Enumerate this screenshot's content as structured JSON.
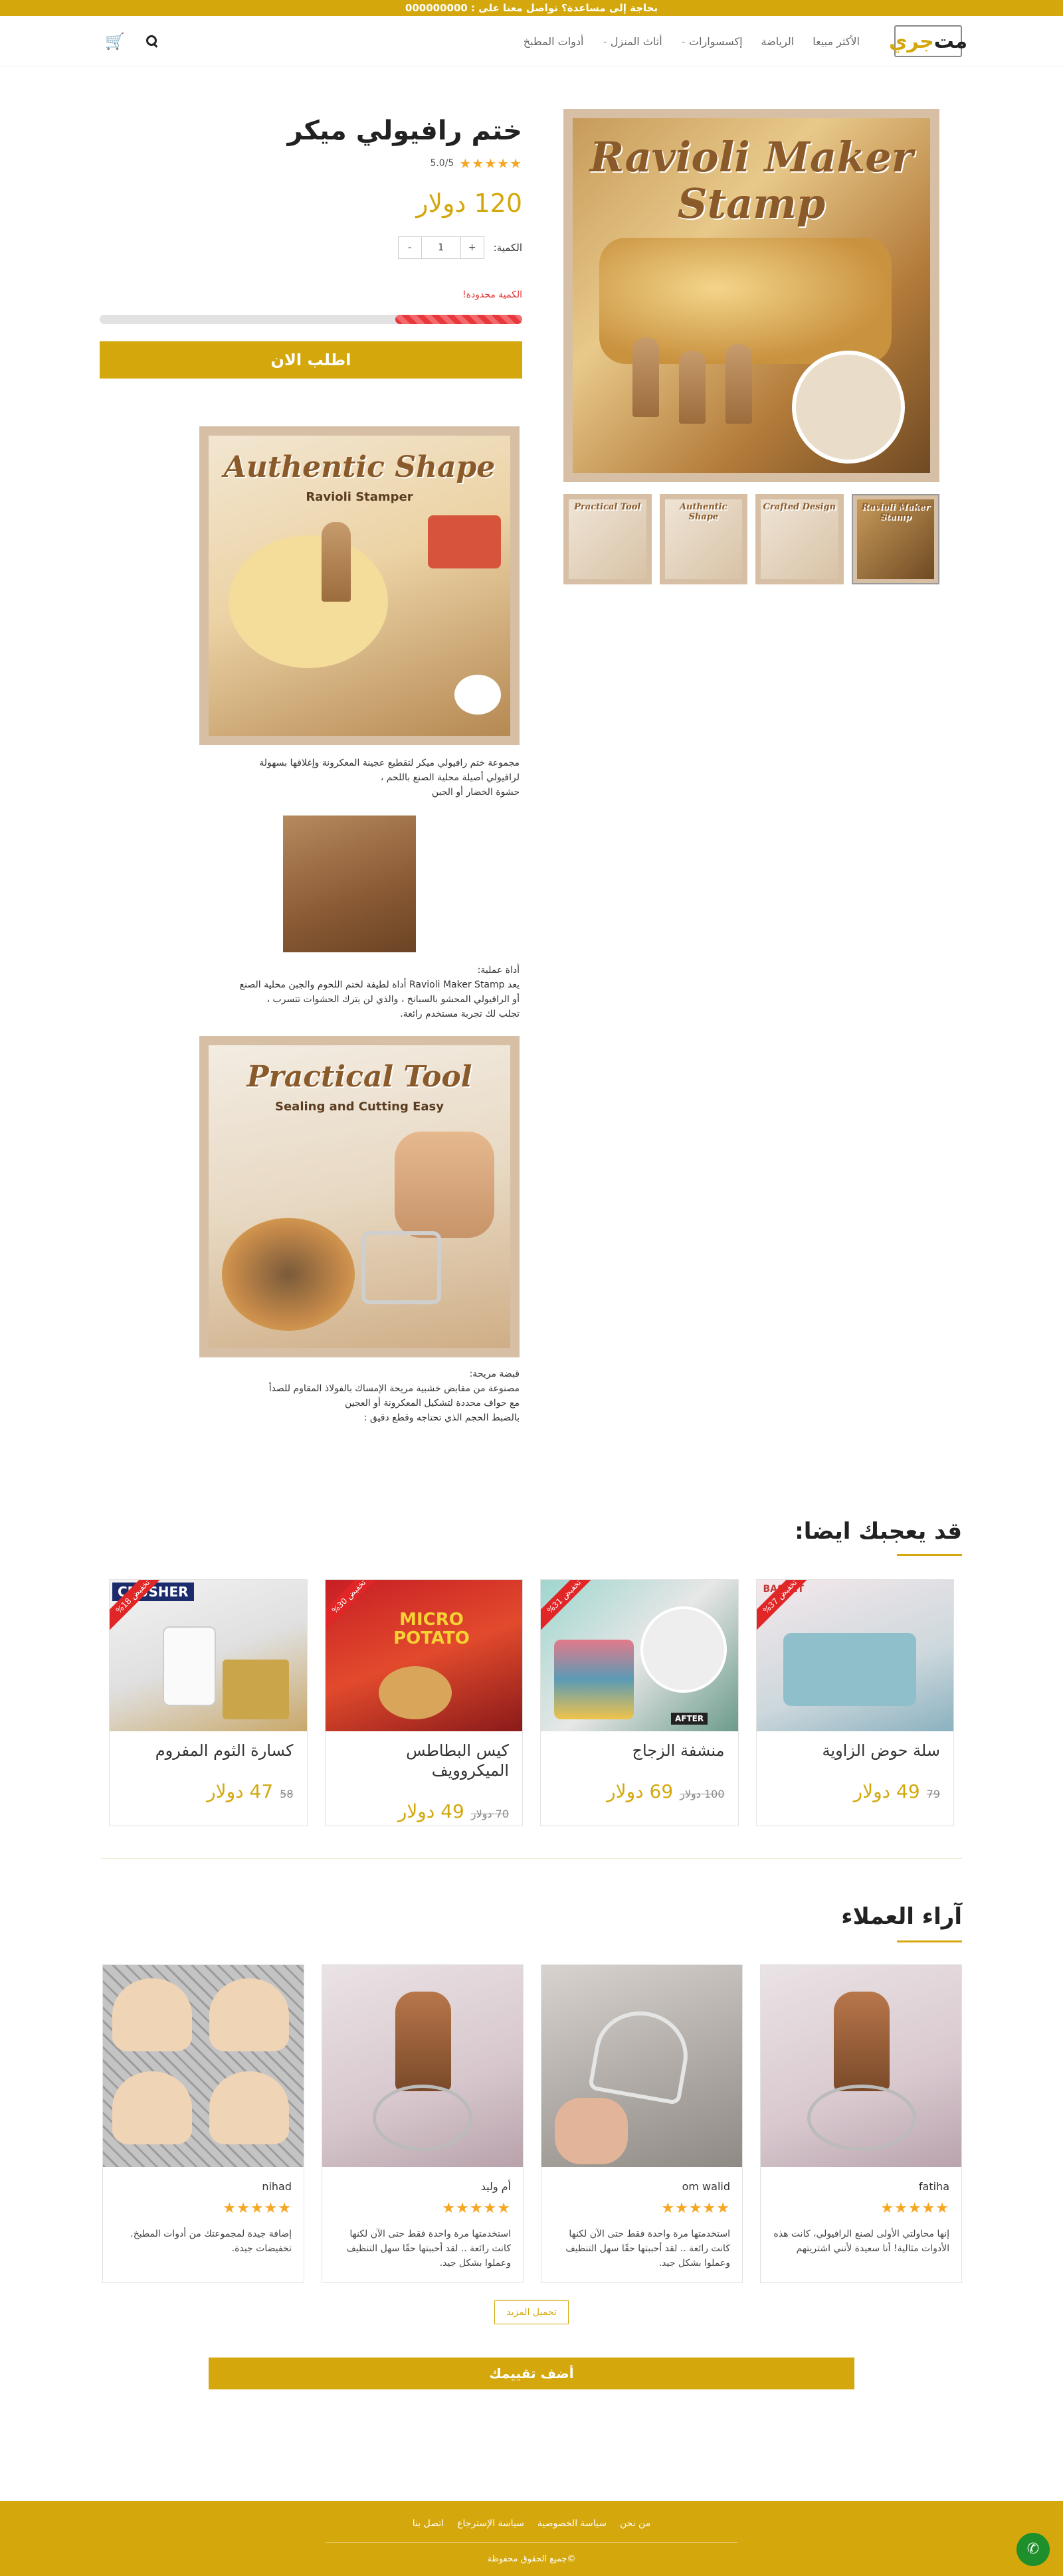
{
  "topbar": {
    "text": "بحاجة إلى مساعدة؟ تواصل معنا على : 000000000"
  },
  "header": {
    "logo_prefix": "مت",
    "logo_accent": "جري",
    "nav": [
      {
        "label": "الأكثر مبيعا",
        "has_menu": false
      },
      {
        "label": "الرياضة",
        "has_menu": false
      },
      {
        "label": "إكسسوارات",
        "has_menu": true
      },
      {
        "label": "أثاث المنزل",
        "has_menu": true
      },
      {
        "label": "أدوات المطبخ",
        "has_menu": false
      }
    ],
    "cart_icon": "🛒"
  },
  "product": {
    "title": "ختم رافيولي ميكر",
    "stars": "★★★★★",
    "rating": "5.0/5",
    "price": "120 دولار",
    "qty_label": "الكمية:",
    "qty_value": "1",
    "qty_minus": "-",
    "qty_plus": "+",
    "limited_label": "الكمية محدودة!",
    "stock_fraction": 0.3,
    "order_button": "اطلب الان",
    "main_image": {
      "title": "Ravioli Maker Stamp"
    },
    "thumbnails": [
      "Practical Tool",
      "Authentic Shape",
      "Crafted Design",
      "Ravioli Maker Stamp"
    ]
  },
  "description": {
    "image1": {
      "title": "Authentic Shape",
      "subtitle": "Ravioli Stamper"
    },
    "text1_line1": "مجموعة ختم رافيولي ميكر لتقطيع عجينة المعكرونة وإغلاقها بسهولة",
    "text1_line2": "لرافيولي أصيلة محلية الصنع باللحم ،",
    "text1_line3": "حشوة الخضار أو الجبن",
    "text2_line1": "أداة عملية:",
    "text2_line2": "يعد Ravioli Maker Stamp أداة لطيفة لختم اللحوم والجبن محلية الصنع",
    "text2_line3": "أو الرافيولي المحشو بالسبانخ ، والذي لن يترك الحشوات تتسرب ،",
    "text2_line4": "تجلب لك تجربة مستخدم رائعة.",
    "image2": {
      "title": "Practical Tool",
      "subtitle": "Sealing and Cutting Easy"
    },
    "text3_line1": "قبضة مريحة:",
    "text3_line2": "مصنوعة من مقابض خشبية مريحة الإمساك بالفولاذ المقاوم للصدأ",
    "text3_line3": "مع حواف محددة لتشكيل المعكرونة أو العجين",
    "text3_line4": "بالضبط الحجم الذي تحتاجه وقطع دقيق :"
  },
  "recommended": {
    "title": "قد يعجبك ايضا:",
    "items": [
      {
        "name": "سلة حوض الزاوية",
        "price": "49 دولار",
        "old_price": "79",
        "badge": "تخفيض 37%"
      },
      {
        "name": "منشفة الزجاج",
        "price": "69 دولار",
        "old_price": "100 دولار",
        "badge": "تخفيض 31%"
      },
      {
        "name": "كيس البطاطس الميكروويف",
        "price": "49 دولار",
        "old_price": "70 دولار",
        "badge": "تخفيض 30%"
      },
      {
        "name": "كسارة الثوم المفروم",
        "price": "47 دولار",
        "old_price": "58",
        "badge": "تخفيض 18%"
      }
    ],
    "image_labels": {
      "potato": "MICRO POTATO",
      "crusher": "CRUSHER",
      "after": "AFTER",
      "basket": "BASKET"
    }
  },
  "reviews": {
    "title": "آراء العملاء",
    "items": [
      {
        "name": "fatiha",
        "stars": "★★★★★",
        "text": "إنها محاولتي الأولى لصنع الرافيولي، كانت هذه الأدوات مثالية! أنا سعيدة لأنني اشتريتهم"
      },
      {
        "name": "om walid",
        "stars": "★★★★★",
        "text": "استخدمتها مرة واحدة فقط حتى الآن لكنها كانت رائعة .. لقد أحببتها حقًا سهل التنظيف وعملوا بشكل جيد."
      },
      {
        "name": "أم وليد",
        "stars": "★★★★★",
        "text": "استخدمتها مرة واحدة فقط حتى الآن لكنها كانت رائعة .. لقد أحببتها حقًا سهل التنظيف وعملوا بشكل جيد."
      },
      {
        "name": "nihad",
        "stars": "★★★★★",
        "text": "إضافة جيدة لمجموعتك من أدوات المطبخ. تخفيضات جيدة."
      }
    ],
    "load_more": "تحميل المزيد",
    "add_review": "أضف تقييمك"
  },
  "footer": {
    "links": [
      "من نحن",
      "سياسة الخصوصية",
      "سياسة الإسترجاع",
      "اتصل بنا"
    ],
    "copyright": "©جميع الحقوق محفوظة"
  },
  "colors": {
    "accent": "#d4a80c",
    "sale": "#e02626",
    "whatsapp": "#1e8f2b"
  }
}
